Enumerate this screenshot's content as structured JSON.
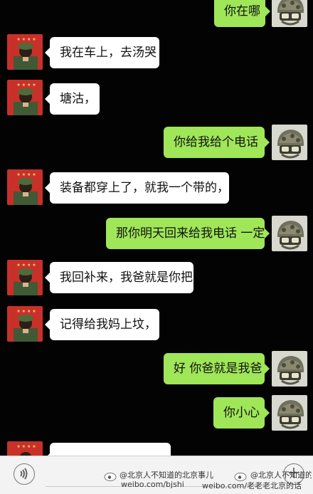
{
  "messages": [
    {
      "side": "right",
      "text": "你在哪"
    },
    {
      "side": "left",
      "text": "我在车上，去汤哭"
    },
    {
      "side": "left",
      "text": "塘沽，"
    },
    {
      "side": "right",
      "text": "你给我给个电话"
    },
    {
      "side": "left",
      "text": "装备都穿上了，就我一个带的，"
    },
    {
      "side": "right",
      "text": "那你明天回来给我电话 一定"
    },
    {
      "side": "left",
      "text": "我回补来，我爸就是你把"
    },
    {
      "side": "left",
      "text": "记得给我妈上坟，"
    },
    {
      "side": "right",
      "text": "好 你爸就是我爸"
    },
    {
      "side": "right",
      "text": "你小心"
    },
    {
      "side": "left",
      "text": ""
    }
  ],
  "input_bar": {
    "voice_icon": "voice-icon",
    "plus_icon": "plus-icon",
    "plus_glyph": "+"
  },
  "watermark": {
    "line1": "@北京人不知道的北京事儿",
    "line2": "weibo.com/bjshi",
    "line3": "@北京人不知道的北京事儿",
    "line4": "weibo.com/老老老北京的话"
  },
  "colors": {
    "background": "#030303",
    "left_bubble": "#ffffff",
    "right_bubble": "#9fe658"
  }
}
